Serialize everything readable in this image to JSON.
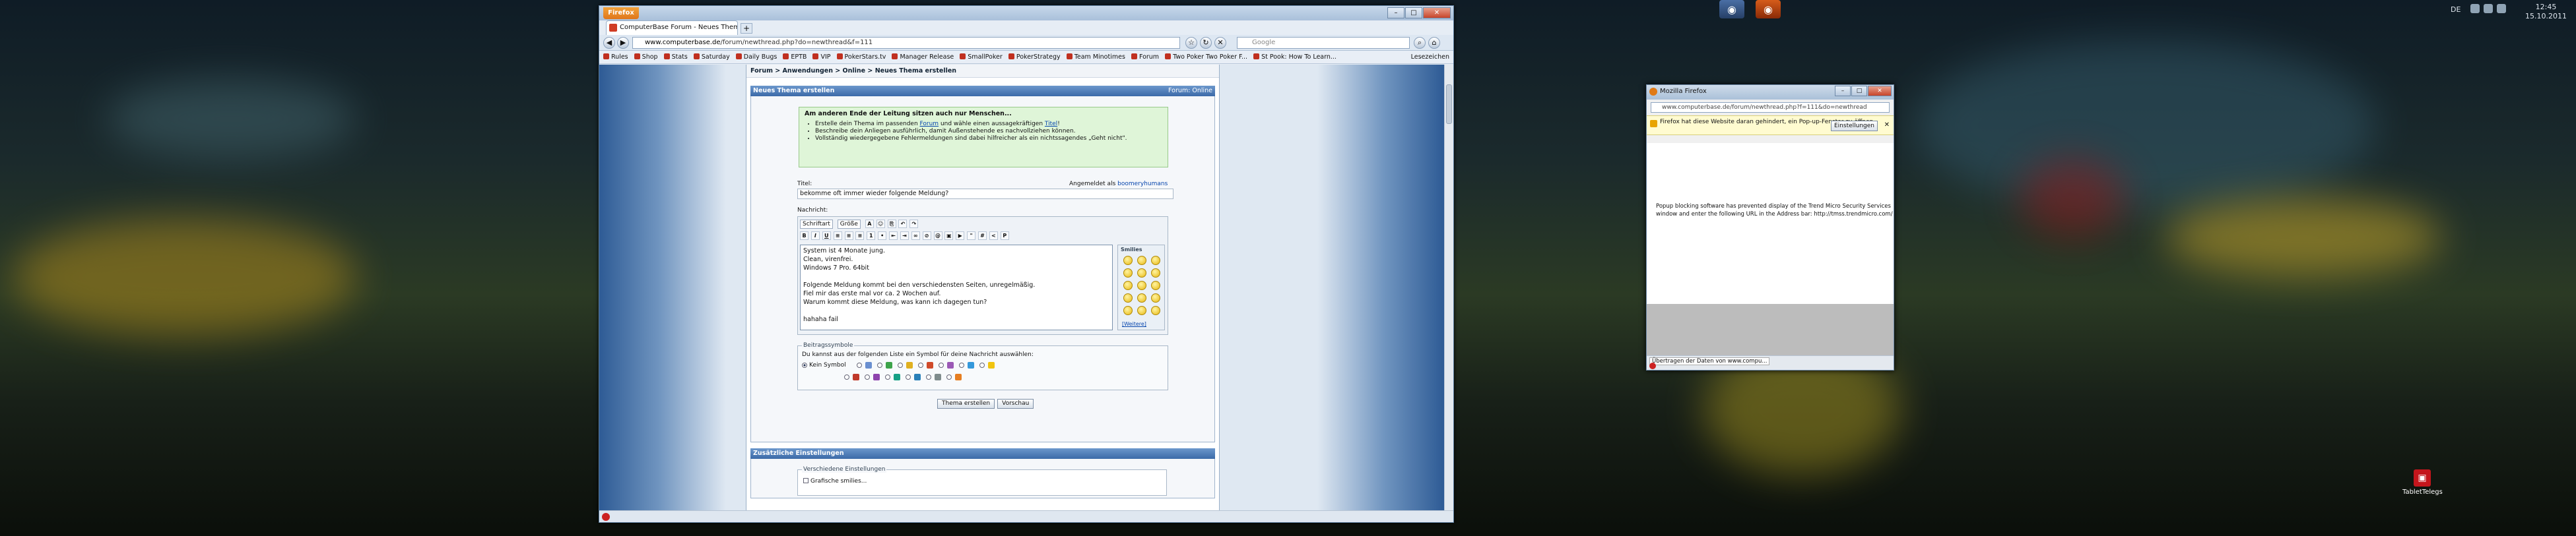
{
  "taskbar": {
    "lang": "DE",
    "time": "12:45",
    "date": "15.10.2011",
    "desktop_icon_label": "TabletTelegs"
  },
  "browser": {
    "menu_button": "Firefox",
    "tab_title": "ComputerBase Forum - Neues Thema er...",
    "new_tab": "+",
    "url_host": "www.computerbase.de",
    "url_path": "/forum/newthread.php?do=newthread&f=111",
    "search_placeholder": "Google",
    "bookmarks": [
      "Rules",
      "Shop",
      "Stats",
      "Saturday",
      "Daily Bugs",
      "EPTB",
      "VIP",
      "PokerStars.tv",
      "Manager Release",
      "SmallPoker",
      "PokerStrategy",
      "Team Minotimes",
      "Forum",
      "Two Poker Two Poker F...",
      "St Pook: How To Learn..."
    ],
    "bookmarks_right": "Lesezeichen",
    "win_min": "–",
    "win_max": "□",
    "win_close": "✕"
  },
  "page": {
    "breadcrumb": "Forum > Anwendungen > Online > Neues Thema erstellen",
    "panel_title": "Neues Thema erstellen",
    "panel_right": "Forum: Online",
    "note": {
      "heading": "Am anderen Ende der Leitung sitzen auch nur Menschen...",
      "item1_pre": "Erstelle dein Thema im passenden ",
      "item1_link1": "Forum",
      "item1_mid": " und wähle einen aussagekräftigen ",
      "item1_link2": "Titel",
      "item1_post": "!",
      "item2": "Beschreibe dein Anliegen ausführlich, damit Außenstehende es nachvollziehen können.",
      "item3": "Vollständig wiedergegebene Fehlermeldungen sind dabei hilfreicher als ein nichtssagendes „Geht nicht\"."
    },
    "title_label": "Titel:",
    "logged_in_pre": "Angemeldet als ",
    "logged_in_user": "boomeryhumans",
    "title_value": "bekomme oft immer wieder folgende Meldung?",
    "message_label": "Nachricht:",
    "font_select": "Schriftart",
    "size_select": "Größe",
    "message_text": "System ist 4 Monate jung.\nClean, virenfrei.\nWindows 7 Pro. 64bit\n\nFolgende Meldung kommt bei den verschiedensten Seiten, unregelmäßig.\nFiel mir das erste mal vor ca. 2 Wochen auf.\nWarum kommt diese Meldung, was kann ich dagegen tun?\n\nhahaha fail",
    "smilies_title": "Smilies",
    "smilies_more": "[Weitere]",
    "icons_legend": "Beitragssymbole",
    "icons_prompt": "Du kannst aus der folgenden Liste ein Symbol für deine Nachricht auswählen:",
    "icons_none": "Kein Symbol",
    "btn_submit": "Thema erstellen",
    "btn_preview": "Vorschau",
    "panel2_title": "Zusätzliche Einstellungen",
    "panel2_legend": "Verschiedene Einstellungen",
    "panel2_option": "Grafische smilies..."
  },
  "popup": {
    "title": "Mozilla Firefox",
    "url": "www.computerbase.de/forum/newthread.php?f=111&do=newthread",
    "infobar_text": "Firefox hat diese Website daran gehindert, ein Pop-up-Fenster zu öffnen.",
    "infobar_button": "Einstellungen",
    "infobar_close": "✕",
    "message_line1": "Popup blocking software has prevented display of the Trend Micro Security Services",
    "message_line2": "window and enter the following URL in the Address bar: http://tmss.trendmicro.com/",
    "status": "Übertragen der Daten von www.compu..."
  },
  "colors": {
    "accent": "#3b6aa8",
    "note_bg": "#dff5d8",
    "firefox_orange": "#e0761a"
  }
}
